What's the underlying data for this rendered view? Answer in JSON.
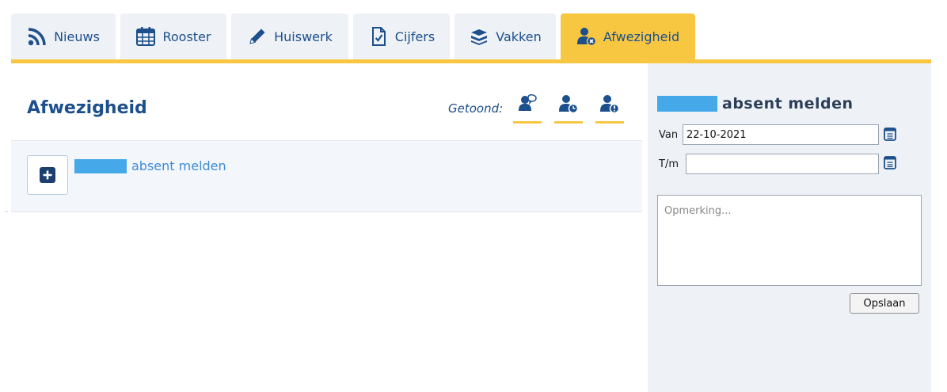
{
  "tabs": [
    {
      "label": "Nieuws",
      "icon": "rss-icon",
      "active": false
    },
    {
      "label": "Rooster",
      "icon": "calendar-icon",
      "active": false
    },
    {
      "label": "Huiswerk",
      "icon": "pencil-icon",
      "active": false
    },
    {
      "label": "Cijfers",
      "icon": "checked-document-icon",
      "active": false
    },
    {
      "label": "Vakken",
      "icon": "books-icon",
      "active": false
    },
    {
      "label": "Afwezigheid",
      "icon": "user-absent-icon",
      "active": true
    }
  ],
  "main": {
    "title": "Afwezigheid",
    "shown_label": "Getoond:",
    "filters": [
      {
        "name": "users-speech-icon"
      },
      {
        "name": "user-clock-icon"
      },
      {
        "name": "user-warning-icon"
      }
    ],
    "add_label": "absent melden"
  },
  "form": {
    "title": "absent melden",
    "from_label": "Van",
    "from_value": "22-10-2021",
    "to_label": "T/m",
    "to_value": "",
    "remark_placeholder": "Opmerking...",
    "save_label": "Opslaan"
  },
  "colors": {
    "accent": "#f8c742",
    "brand": "#1c4f8c",
    "link": "#3d8bd8",
    "redaction": "#45a8e8"
  }
}
